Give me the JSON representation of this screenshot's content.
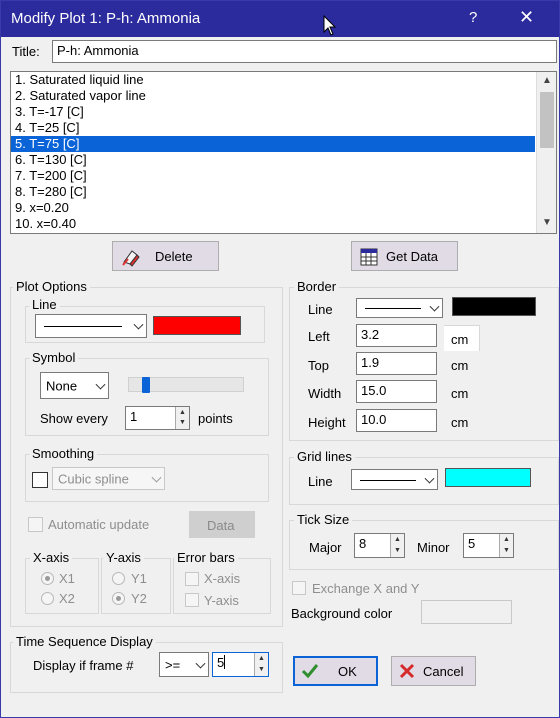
{
  "window": {
    "title": "Modify Plot 1: P-h: Ammonia",
    "help_glyph": "?",
    "close_glyph": "✕"
  },
  "title_field": {
    "label": "Title:",
    "value": "P-h: Ammonia"
  },
  "plot_list": {
    "items": [
      "1.  Saturated liquid line",
      "2.  Saturated vapor line",
      "3.  T=-17 [C]",
      "4.  T=25 [C]",
      "5.  T=75 [C]",
      "6.  T=130 [C]",
      "7.  T=200 [C]",
      "8.  T=280 [C]",
      "9.  x=0.20",
      "10.  x=0.40"
    ],
    "selected_index": 4
  },
  "buttons": {
    "delete": "Delete",
    "get_data": "Get Data",
    "data": "Data",
    "ok": "OK",
    "cancel": "Cancel"
  },
  "plot_options": {
    "legend": "Plot Options",
    "line": {
      "legend": "Line",
      "color": "#ff0000"
    },
    "symbol": {
      "legend": "Symbol",
      "value": "None",
      "show_every_label": "Show every",
      "show_every_value": "1",
      "points_label": "points",
      "slider_fraction": 0.12
    },
    "smoothing": {
      "legend": "Smoothing",
      "value": "Cubic spline",
      "checked": false
    },
    "automatic_update": {
      "label": "Automatic update",
      "checked": false
    },
    "x_axis": {
      "legend": "X-axis",
      "options": [
        "X1",
        "X2"
      ],
      "selected": "X1"
    },
    "y_axis": {
      "legend": "Y-axis",
      "options": [
        "Y1",
        "Y2"
      ],
      "selected": "Y2"
    },
    "error_bars": {
      "legend": "Error bars",
      "options": [
        "X-axis",
        "Y-axis"
      ]
    }
  },
  "border": {
    "legend": "Border",
    "line_label": "Line",
    "color": "#000000",
    "left": {
      "label": "Left",
      "value": "3.2",
      "unit": "cm"
    },
    "top": {
      "label": "Top",
      "value": "1.9",
      "unit": "cm"
    },
    "width": {
      "label": "Width",
      "value": "15.0",
      "unit": "cm"
    },
    "height": {
      "label": "Height",
      "value": "10.0",
      "unit": "cm"
    }
  },
  "grid_lines": {
    "legend": "Grid lines",
    "line_label": "Line",
    "color": "#00ffff"
  },
  "tick_size": {
    "legend": "Tick Size",
    "major_label": "Major",
    "major_value": "8",
    "minor_label": "Minor",
    "minor_value": "5"
  },
  "exchange_xy": {
    "label": "Exchange X and Y",
    "checked": false
  },
  "background_color": {
    "label": "Background color"
  },
  "time_sequence": {
    "legend": "Time Sequence Display",
    "label": "Display if frame #",
    "operator": ">=",
    "value": "5"
  }
}
